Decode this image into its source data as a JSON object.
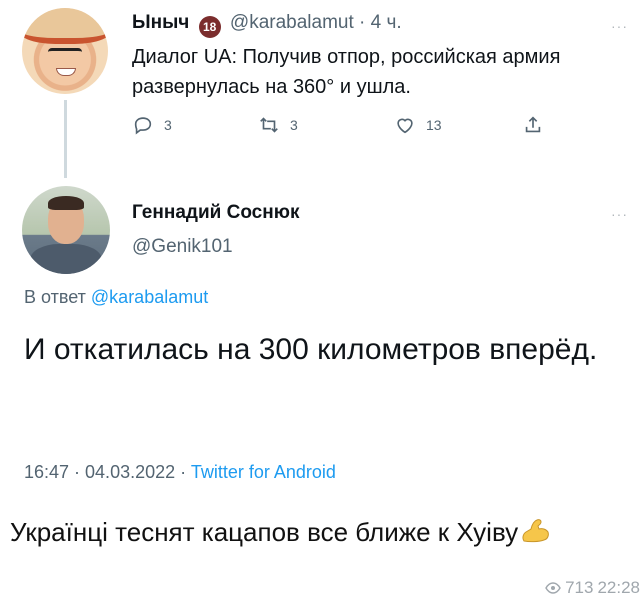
{
  "tweet1": {
    "name": "Ыныч",
    "badge": "18",
    "handle": "@karabalamut",
    "separator": "·",
    "time": "4 ч.",
    "text": "Диалог UA: Получив отпор, российская армия развернулась на 360° и ушла.",
    "replies": "3",
    "retweets": "3",
    "likes": "13",
    "more": "···"
  },
  "tweet2": {
    "name": "Геннадий Соснюк",
    "handle": "@Genik101",
    "reply_prefix": "В ответ",
    "reply_handle": "@karabalamut",
    "text": "И откатилась на 300 километров вперёд.",
    "time": "16:47 · 04.03.2022 ·",
    "client": "Twitter for Android",
    "more": "···"
  },
  "caption": {
    "text": "Українці теснят кацапов все ближе к Хуіву"
  },
  "views": {
    "count": "713",
    "time": "22:28"
  },
  "colors": {
    "link": "#1d9bf0",
    "secondary": "#536471",
    "text": "#0f1419"
  }
}
